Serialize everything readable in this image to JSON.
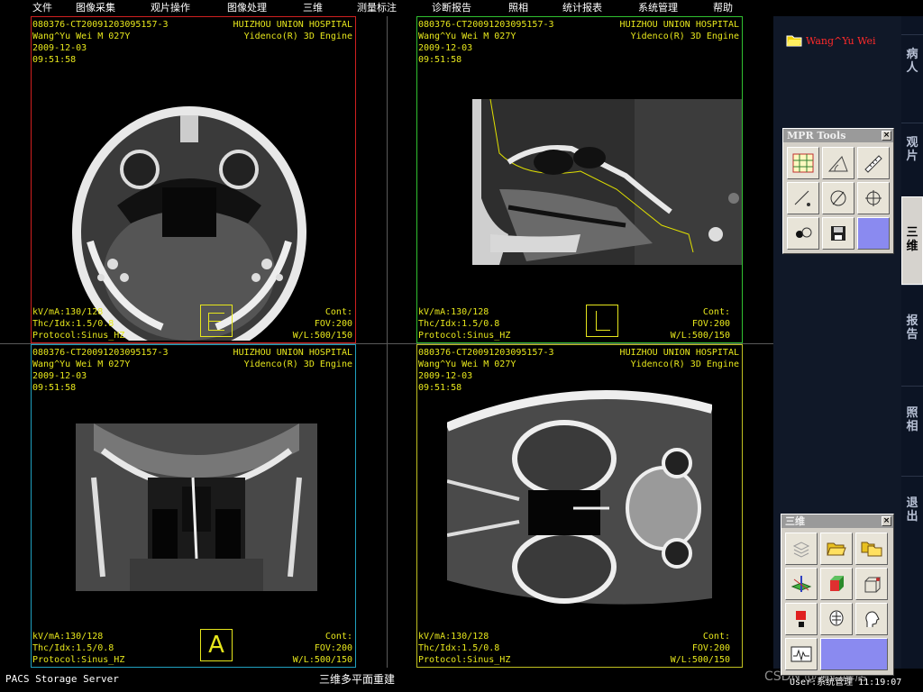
{
  "menu": [
    "文件",
    "图像采集",
    "观片操作",
    "图像处理",
    "三维",
    "测量标注",
    "诊断报告",
    "照相",
    "统计报表",
    "系统管理",
    "帮助"
  ],
  "viewports": {
    "top_left": {
      "study_id": "080376-CT20091203095157-3",
      "patient_line": "Wang^Yu Wei M 027Y",
      "date": "2009-12-03",
      "time": "09:51:58",
      "hospital": "HUIZHOU UNION HOSPITAL",
      "engine": "Yidenco(R) 3D Engine",
      "kvma": "kV/mA:130/128",
      "thc": "Thc/Idx:1.5/0.8",
      "protocol": "Protocol:Sinus_HZ",
      "cont": "Cont:",
      "fov": "FOV:200",
      "wl": "W/L:500/150",
      "orientation": "",
      "border_color": "#d02020"
    },
    "top_right": {
      "study_id": "080376-CT20091203095157-3",
      "patient_line": "Wang^Yu Wei M 027Y",
      "date": "2009-12-03",
      "time": "09:51:58",
      "hospital": "HUIZHOU UNION HOSPITAL",
      "engine": "Yidenco(R) 3D Engine",
      "kvma": "kV/mA:130/128",
      "thc": "Thc/Idx:1.5/0.8",
      "protocol": "Protocol:Sinus_HZ",
      "cont": "Cont:",
      "fov": "FOV:200",
      "wl": "W/L:500/150",
      "orientation": "",
      "border_color": "#30c030"
    },
    "bottom_left": {
      "study_id": "080376-CT20091203095157-3",
      "patient_line": "Wang^Yu Wei M 027Y",
      "date": "2009-12-03",
      "time": "09:51:58",
      "hospital": "HUIZHOU UNION HOSPITAL",
      "engine": "Yidenco(R) 3D Engine",
      "kvma": "kV/mA:130/128",
      "thc": "Thc/Idx:1.5/0.8",
      "protocol": "Protocol:Sinus_HZ",
      "cont": "Cont:",
      "fov": "FOV:200",
      "wl": "W/L:500/150",
      "orientation": "A",
      "border_color": "#20a0c0"
    },
    "bottom_right": {
      "study_id": "080376-CT20091203095157-3",
      "patient_line": "Wang^Yu Wei M 027Y",
      "date": "2009-12-03",
      "time": "09:51:58",
      "hospital": "HUIZHOU UNION HOSPITAL",
      "engine": "Yidenco(R) 3D Engine",
      "kvma": "kV/mA:130/128",
      "thc": "Thc/Idx:1.5/0.8",
      "protocol": "Protocol:Sinus_HZ",
      "cont": "Cont:",
      "fov": "FOV:200",
      "wl": "W/L:500/150",
      "border_color": "#c0c020"
    }
  },
  "status": {
    "left": "PACS Storage Server",
    "center": "三维多平面重建",
    "right": "User:系统管理   11:19:07"
  },
  "watermark": "CSDN @源码库店",
  "patient_panel": {
    "name": "Wang^Yu Wei"
  },
  "mpr_tools": {
    "title": "MPR Tools",
    "close": "×"
  },
  "three_d_tools": {
    "title": "三维",
    "close": "×"
  },
  "side_tabs": [
    {
      "label": "病人",
      "active": false
    },
    {
      "label": "观片",
      "active": false
    },
    {
      "label": "三维",
      "active": true
    },
    {
      "label": "报告",
      "active": false
    },
    {
      "label": "照相",
      "active": false
    },
    {
      "label": "退出",
      "active": false
    }
  ],
  "colors": {
    "overlay": "#e6e61c",
    "accent_red": "#ff2a2a",
    "tool_slot": "#8a8af0"
  }
}
